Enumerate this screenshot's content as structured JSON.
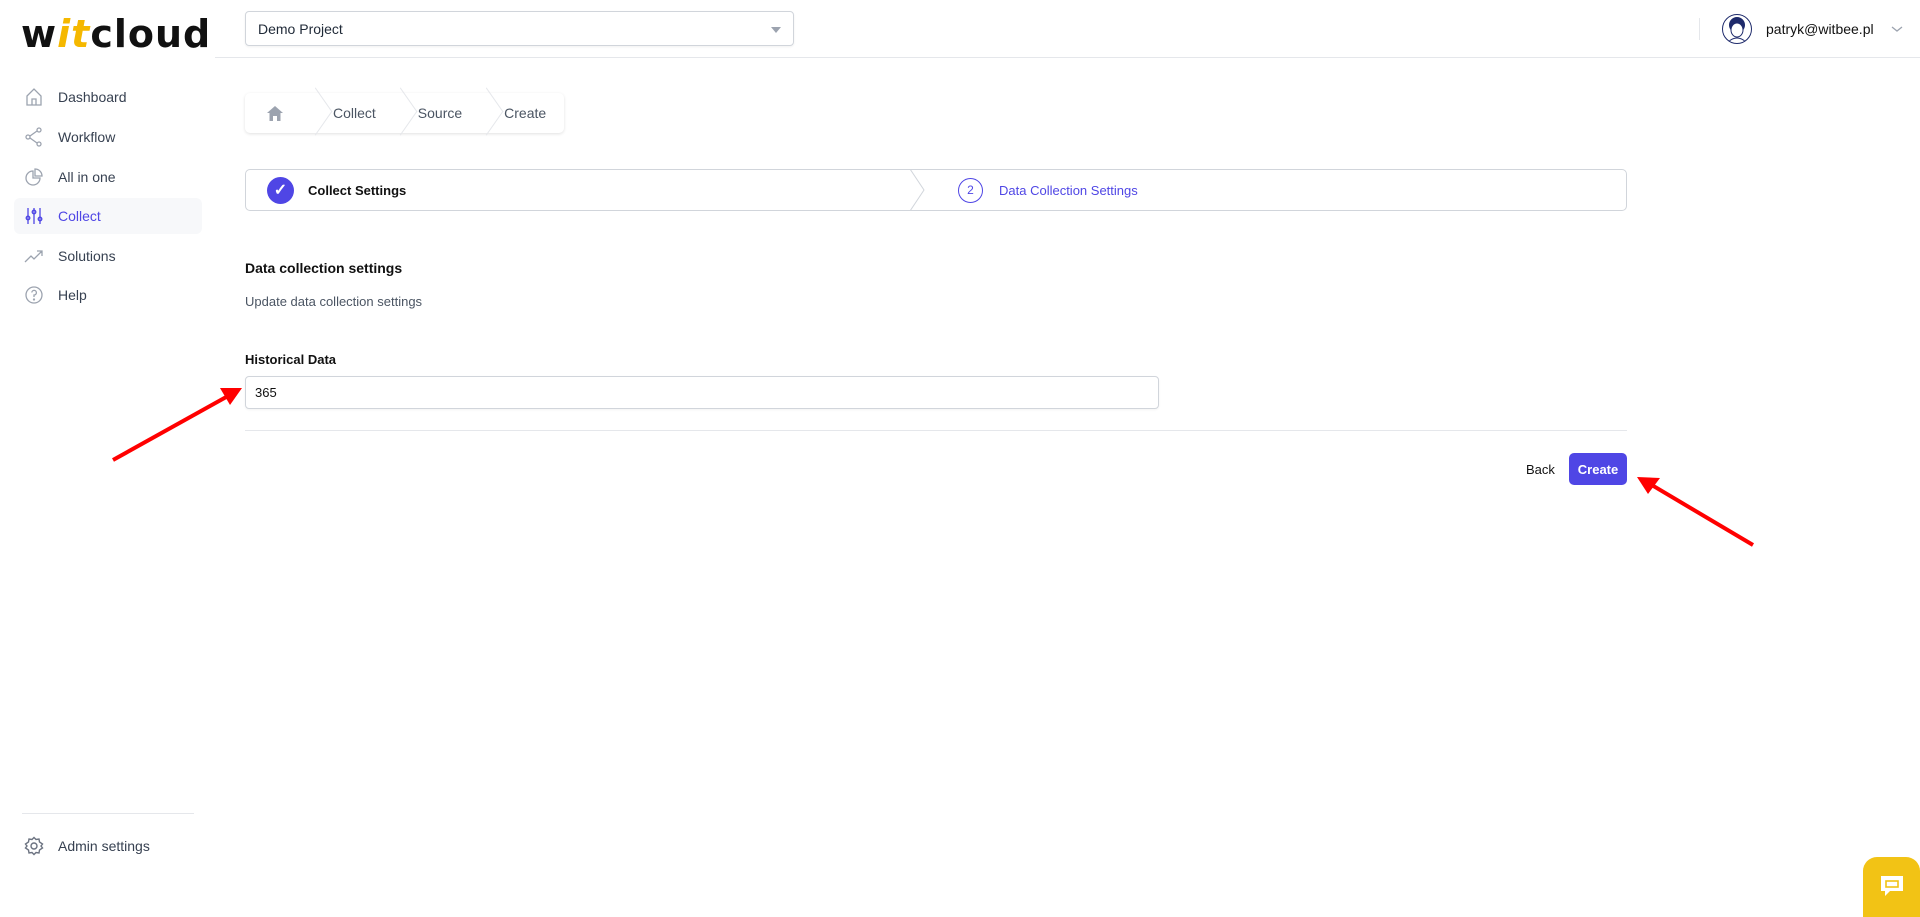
{
  "logo": {
    "part1": "w",
    "part2": "it",
    "part3": "cloud"
  },
  "sidebar": {
    "items": [
      {
        "label": "Dashboard",
        "icon": "home-icon"
      },
      {
        "label": "Workflow",
        "icon": "share-icon"
      },
      {
        "label": "All in one",
        "icon": "pie-chart-icon"
      },
      {
        "label": "Collect",
        "icon": "sliders-icon",
        "active": true
      },
      {
        "label": "Solutions",
        "icon": "trending-up-icon"
      },
      {
        "label": "Help",
        "icon": "help-circle-icon"
      }
    ],
    "admin_label": "Admin settings"
  },
  "header": {
    "project": "Demo Project",
    "user_email": "patryk@witbee.pl"
  },
  "breadcrumb": [
    "Collect",
    "Source",
    "Create"
  ],
  "stepper": {
    "step1": {
      "label": "Collect Settings",
      "status": "done"
    },
    "step2": {
      "number": "2",
      "label": "Data Collection Settings",
      "status": "active"
    }
  },
  "section": {
    "title": "Data collection settings",
    "subtitle": "Update data collection settings"
  },
  "form": {
    "historical_label": "Historical Data",
    "historical_value": "365"
  },
  "actions": {
    "back": "Back",
    "create": "Create"
  },
  "colors": {
    "accent": "#4f46e5",
    "logo_accent": "#f5b800",
    "chat": "#f2c315",
    "annotation": "#ff0000"
  }
}
